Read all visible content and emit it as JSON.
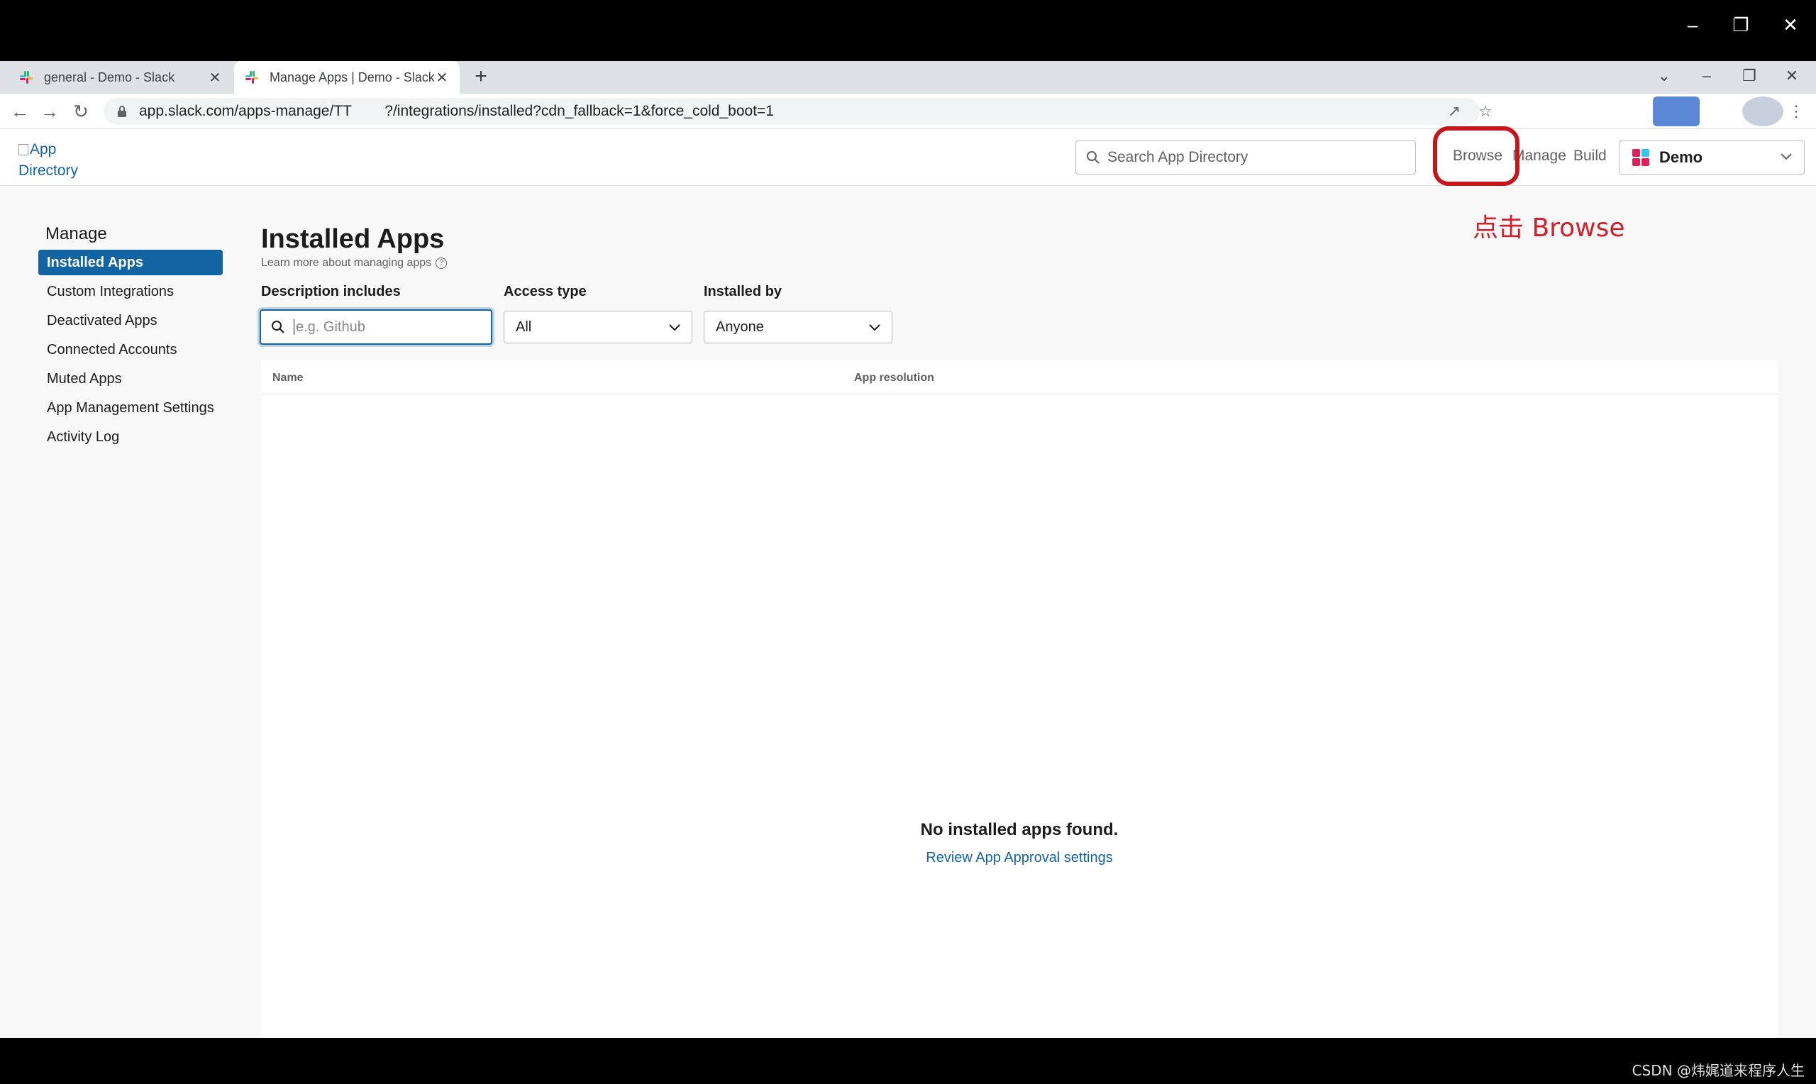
{
  "browser": {
    "tabs": [
      {
        "title": "general - Demo - Slack",
        "active": false
      },
      {
        "title": "Manage Apps | Demo - Slack",
        "active": true
      }
    ],
    "url": "app.slack.com/apps-manage/TT        ?/integrations/installed?cdn_fallback=1&force_cold_boot=1"
  },
  "header": {
    "logo_alt_line1": "App",
    "logo_alt_line2": "Directory",
    "search_placeholder": "Search App Directory",
    "nav": {
      "browse": "Browse",
      "manage": "Manage",
      "build": "Build"
    },
    "workspace": "Demo"
  },
  "annotation": {
    "text": "点击 Browse",
    "color": "#c4161c"
  },
  "sidebar": {
    "title": "Manage",
    "items": [
      {
        "label": "Installed Apps",
        "active": true
      },
      {
        "label": "Custom Integrations"
      },
      {
        "label": "Deactivated Apps"
      },
      {
        "label": "Connected Accounts"
      },
      {
        "label": "Muted Apps"
      },
      {
        "label": "App Management Settings"
      },
      {
        "label": "Activity Log"
      }
    ]
  },
  "main": {
    "title": "Installed Apps",
    "learn_more": "Learn more about managing apps",
    "filters": {
      "description_label": "Description includes",
      "description_placeholder": "e.g. Github",
      "access_label": "Access type",
      "access_value": "All",
      "installed_by_label": "Installed by",
      "installed_by_value": "Anyone"
    },
    "table": {
      "columns": [
        "Name",
        "App resolution"
      ],
      "empty_title": "No installed apps found.",
      "empty_link": "Review App Approval settings"
    }
  },
  "watermark": "CSDN @炜娓道来程序人生",
  "colors": {
    "accent": "#1264a3",
    "annotation_red": "#c4161c"
  }
}
